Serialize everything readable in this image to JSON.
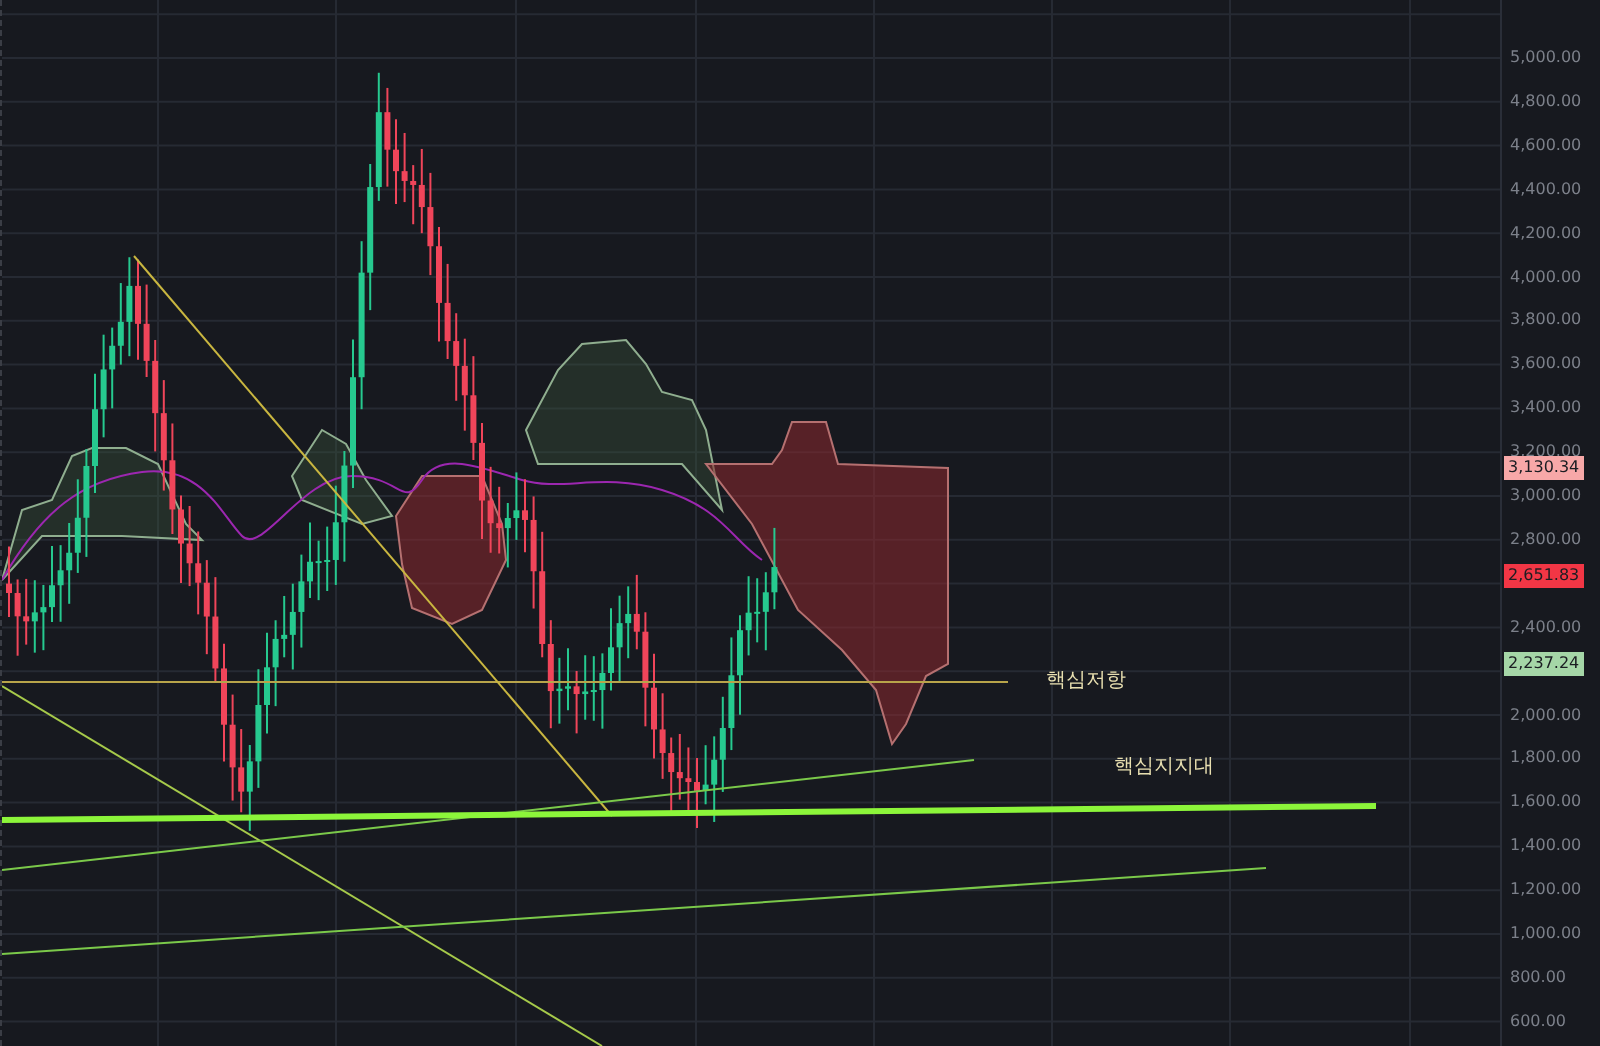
{
  "price_axis": {
    "ticks": [
      "5,000.00",
      "4,800.00",
      "4,600.00",
      "4,400.00",
      "4,200.00",
      "4,000.00",
      "3,800.00",
      "3,600.00",
      "3,400.00",
      "3,200.00",
      "3,000.00",
      "2,800.00",
      "2,400.00",
      "2,000.00",
      "1,800.00",
      "1,600.00",
      "1,400.00",
      "1,200.00",
      "1,000.00",
      "800.00",
      "600.00"
    ]
  },
  "price_labels": [
    {
      "text": "3,130.34",
      "color": "#f7a8a8"
    },
    {
      "text": "2,651.83",
      "color": "#f23645"
    },
    {
      "text": "2,237.24",
      "color": "#a5d6a7"
    }
  ],
  "annotations": [
    {
      "text": "핵심저항"
    },
    {
      "text": "핵심지지대"
    }
  ]
}
